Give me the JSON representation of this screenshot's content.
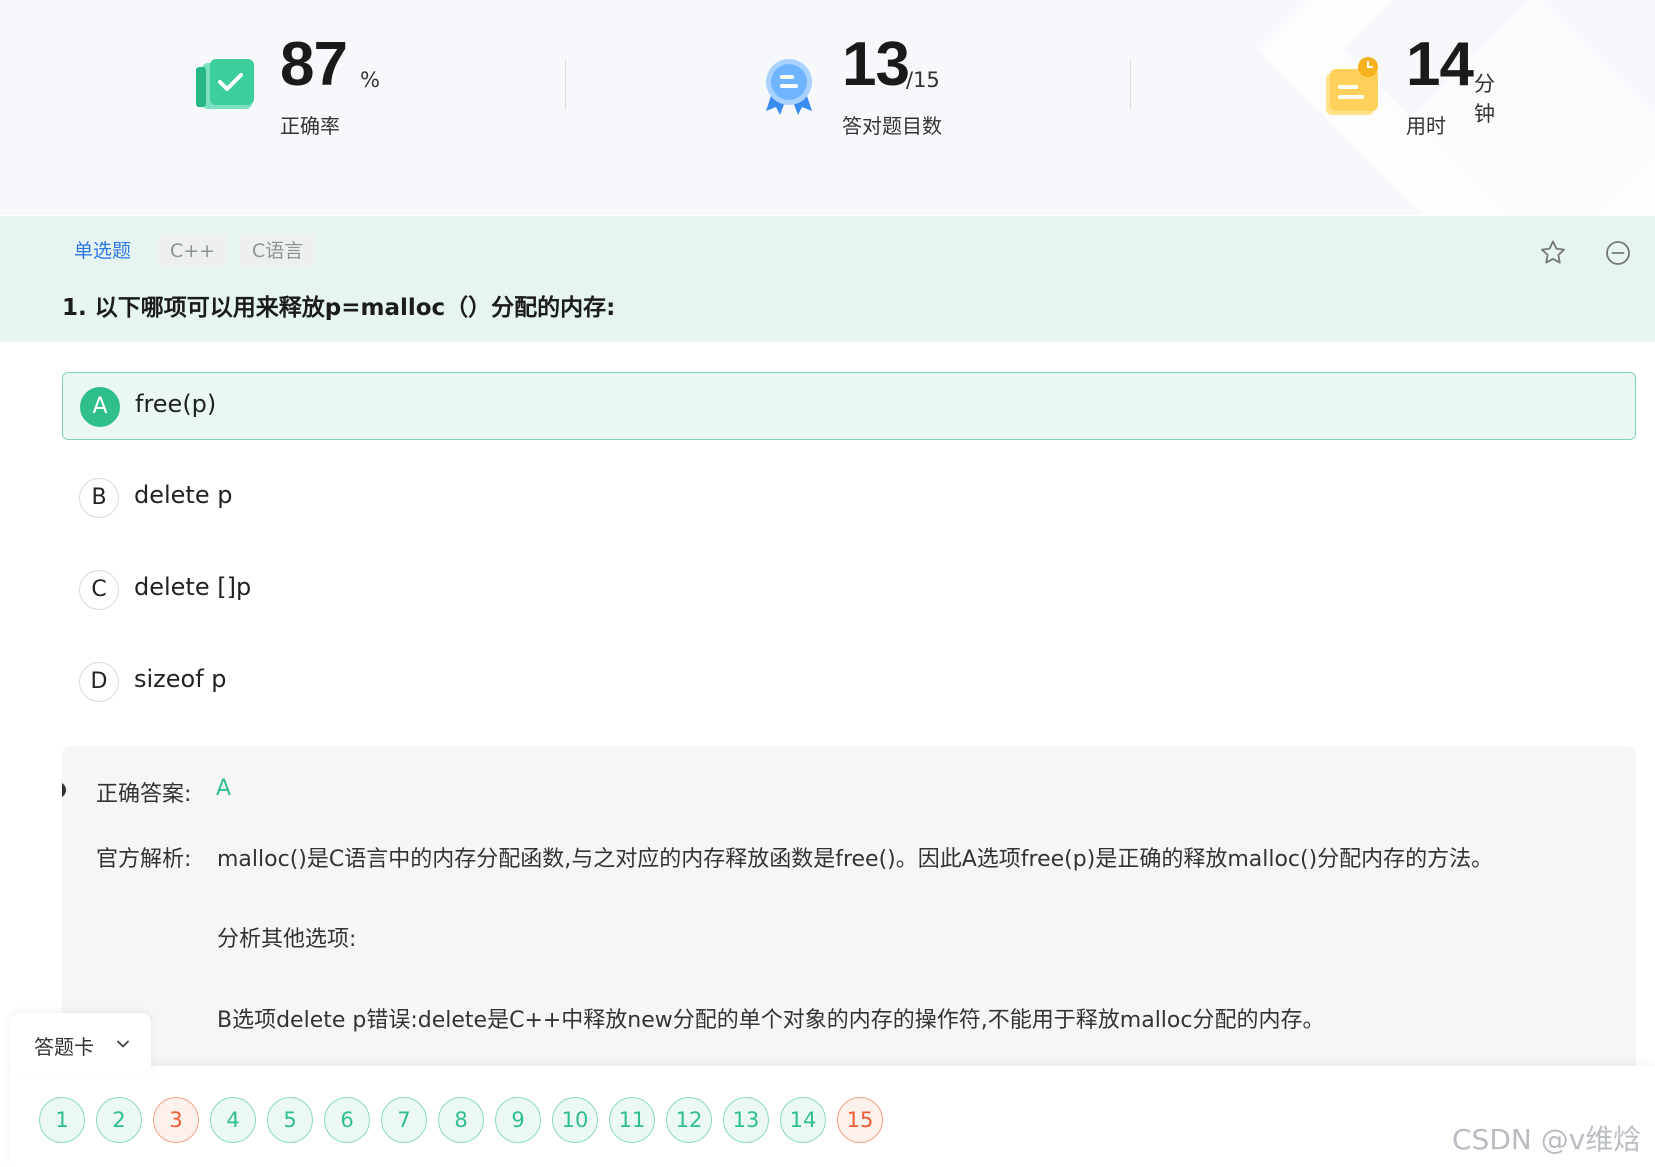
{
  "stats": {
    "accuracy": {
      "value": "87",
      "unit": "%",
      "label": "正确率"
    },
    "correct_count": {
      "value": "13",
      "unit": "/15",
      "label": "答对题目数"
    },
    "time_used": {
      "value": "14",
      "unit": "分钟",
      "label": "用时"
    }
  },
  "question": {
    "tags": {
      "type": "单选题",
      "tag1": "C++",
      "tag2": "C语言"
    },
    "title": "1. 以下哪项可以用来释放p=malloc（）分配的内存:",
    "options": [
      {
        "letter": "A",
        "text": "free(p)"
      },
      {
        "letter": "B",
        "text": "delete p"
      },
      {
        "letter": "C",
        "text": "delete []p"
      },
      {
        "letter": "D",
        "text": "sizeof p"
      }
    ]
  },
  "explanation": {
    "answer_label": "正确答案:",
    "answer_value": "A",
    "analysis_label": "官方解析:",
    "paragraphs": [
      "malloc()是C语言中的内存分配函数,与之对应的内存释放函数是free()。因此A选项free(p)是正确的释放malloc()分配内存的方法。",
      "分析其他选项:",
      "B选项delete p错误:delete是C++中释放new分配的单个对象的内存的操作符,不能用于释放malloc分配的内存。"
    ]
  },
  "answer_card": {
    "label": "答题卡",
    "numbers": [
      "1",
      "2",
      "3",
      "4",
      "5",
      "6",
      "7",
      "8",
      "9",
      "10",
      "11",
      "12",
      "13",
      "14",
      "15"
    ],
    "wrong": [
      "3",
      "15"
    ]
  },
  "watermark": "CSDN @v维焓",
  "colors": {
    "accent": "#2fbf8b",
    "wrong": "#ef5b33",
    "tag_blue": "#2f78e6",
    "header_bg": "#e6f5f1"
  }
}
